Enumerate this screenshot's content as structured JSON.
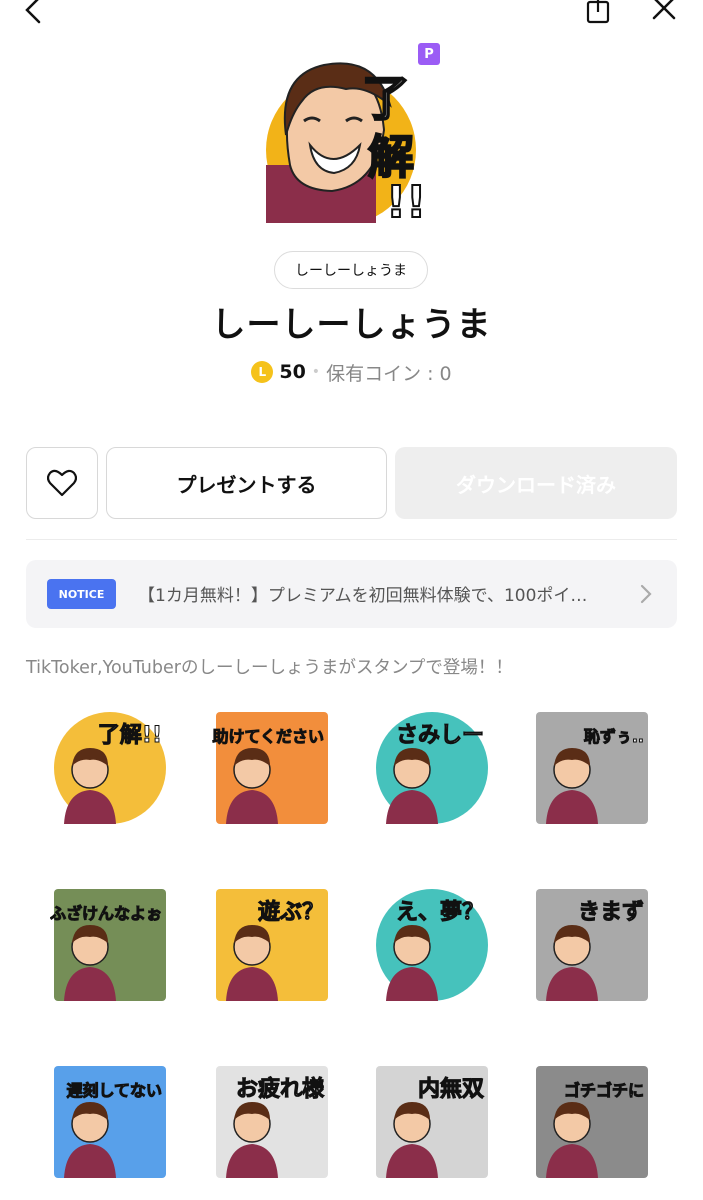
{
  "header": {
    "back_icon": "chevron-left-icon",
    "share_icon": "share-icon",
    "close_icon": "close-icon"
  },
  "hero": {
    "badge": "P",
    "text": "了解!!"
  },
  "author_chip": "しーしーしょうま",
  "title": "しーしーしょうま",
  "price": {
    "coin_symbol": "L",
    "value": "50",
    "owned": "保有コイン : 0"
  },
  "actions": {
    "like_icon": "heart-icon",
    "present_label": "プレゼントする",
    "download_label": "ダウンロード済み"
  },
  "notice": {
    "badge": "NOTICE",
    "text": "【1カ月無料！】プレミアムを初回無料体験で、100ポイ…"
  },
  "description": "TikToker,YouTuberのしーしーしょうまがスタンプで登場！！",
  "stickers": [
    {
      "text": "了解!!",
      "color": "#f2b318"
    },
    {
      "text": "助けてください",
      "color": "#f07a1a"
    },
    {
      "text": "さみしー",
      "color": "#26b7b0"
    },
    {
      "text": "恥ずぅ..",
      "color": "#9a9a9a"
    },
    {
      "text": "ふざけんなよぉ",
      "color": "#5d7a3a"
    },
    {
      "text": "遊ぶ？",
      "color": "#f2b318"
    },
    {
      "text": "え、夢？",
      "color": "#26b7b0"
    },
    {
      "text": "きまず",
      "color": "#9a9a9a"
    },
    {
      "text": "遅刻してない",
      "color": "#3b8fe6"
    },
    {
      "text": "お疲れ様",
      "color": "#dddddd"
    },
    {
      "text": "内無双",
      "color": "#cccccc"
    },
    {
      "text": "ゴチゴチに",
      "color": "#777777"
    }
  ]
}
